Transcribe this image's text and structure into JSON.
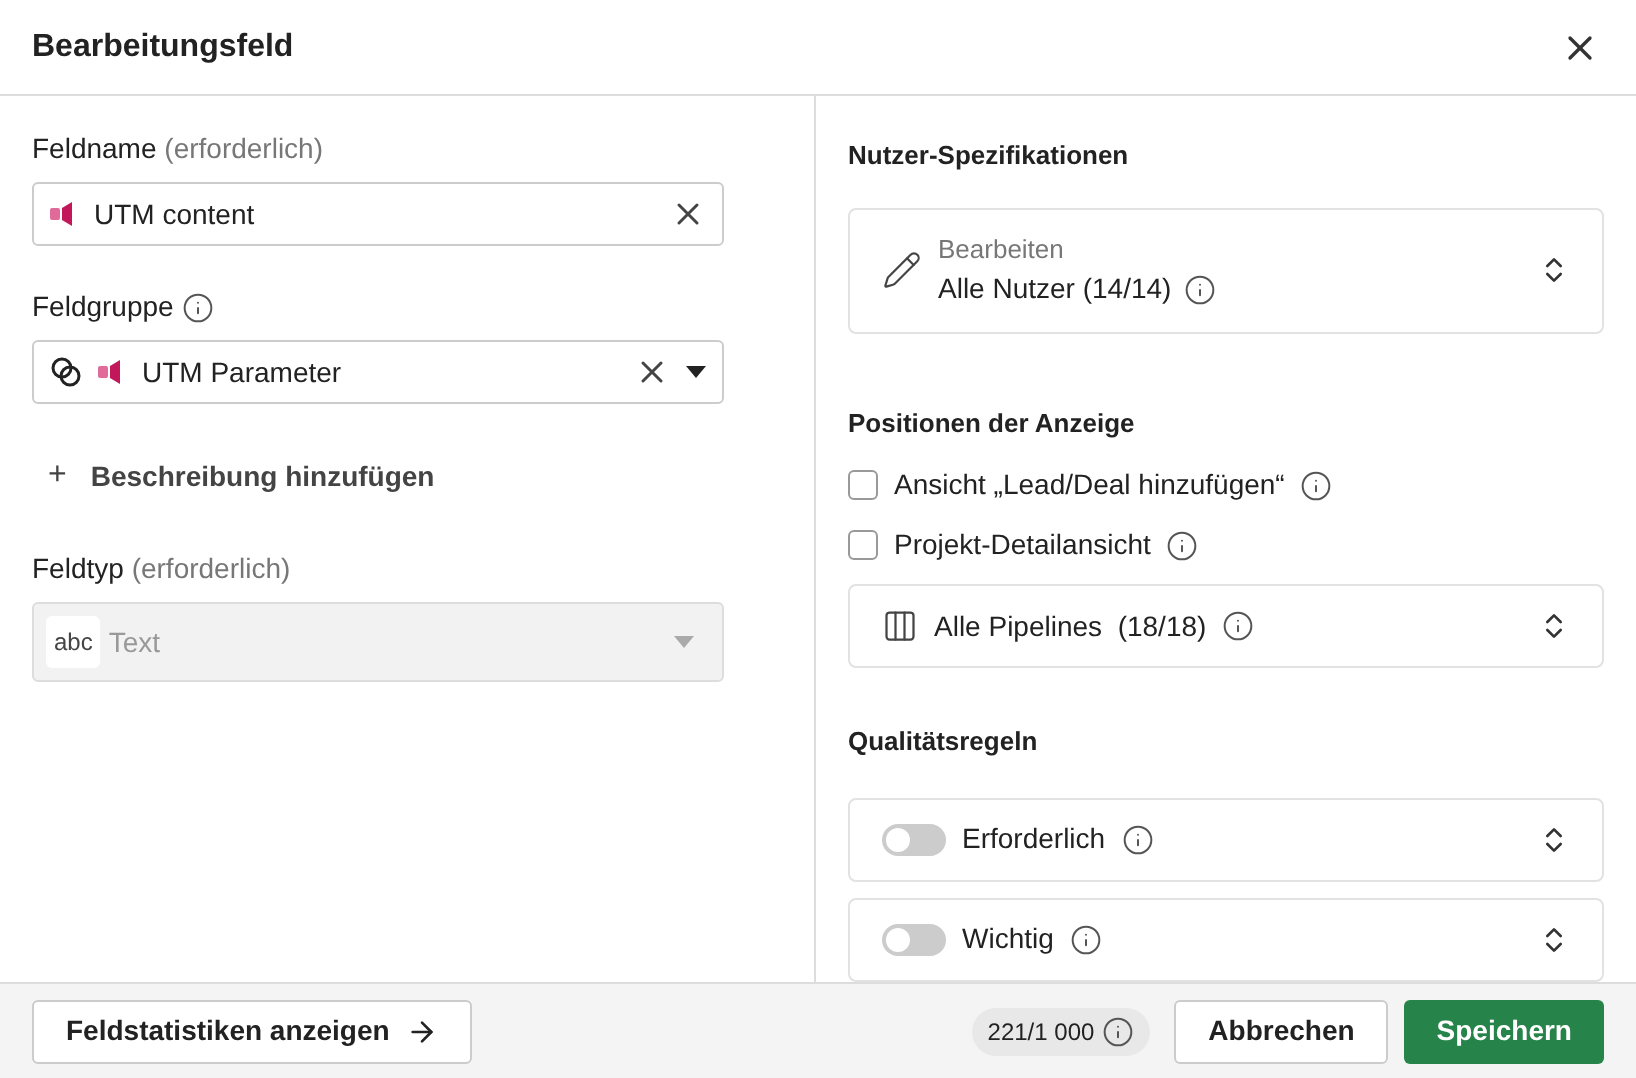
{
  "window": {
    "title": "Bearbeitungsfeld"
  },
  "field_name": {
    "label": "Feldname",
    "hint": "(erforderlich)",
    "value": "UTM content"
  },
  "field_group": {
    "label": "Feldgruppe",
    "value": "UTM Parameter"
  },
  "add_description": {
    "label": "Beschreibung hinzufügen",
    "icon": "+"
  },
  "field_type": {
    "label": "Feldtyp",
    "hint": "(erforderlich)",
    "badge": "abc",
    "value": "Text",
    "disabled": true
  },
  "user_specs": {
    "heading": "Nutzer-Spezifikationen",
    "caption": "Bearbeiten",
    "value": "Alle Nutzer (14/14)"
  },
  "display_positions": {
    "heading": "Positionen der Anzeige",
    "checkboxes": [
      {
        "label": "Ansicht „Lead/Deal hinzufügen“",
        "checked": false
      },
      {
        "label": "Projekt-Detailansicht",
        "checked": false
      }
    ],
    "pipelines": "Alle Pipelines  (18/18)"
  },
  "quality_rules": {
    "heading": "Qualitätsregeln",
    "toggles": [
      {
        "label": "Erforderlich",
        "on": false
      },
      {
        "label": "Wichtig",
        "on": false
      }
    ]
  },
  "footer": {
    "stats_button": "Feldstatistiken anzeigen",
    "counter": "221/1 000",
    "cancel": "Abbrechen",
    "save": "Speichern"
  }
}
